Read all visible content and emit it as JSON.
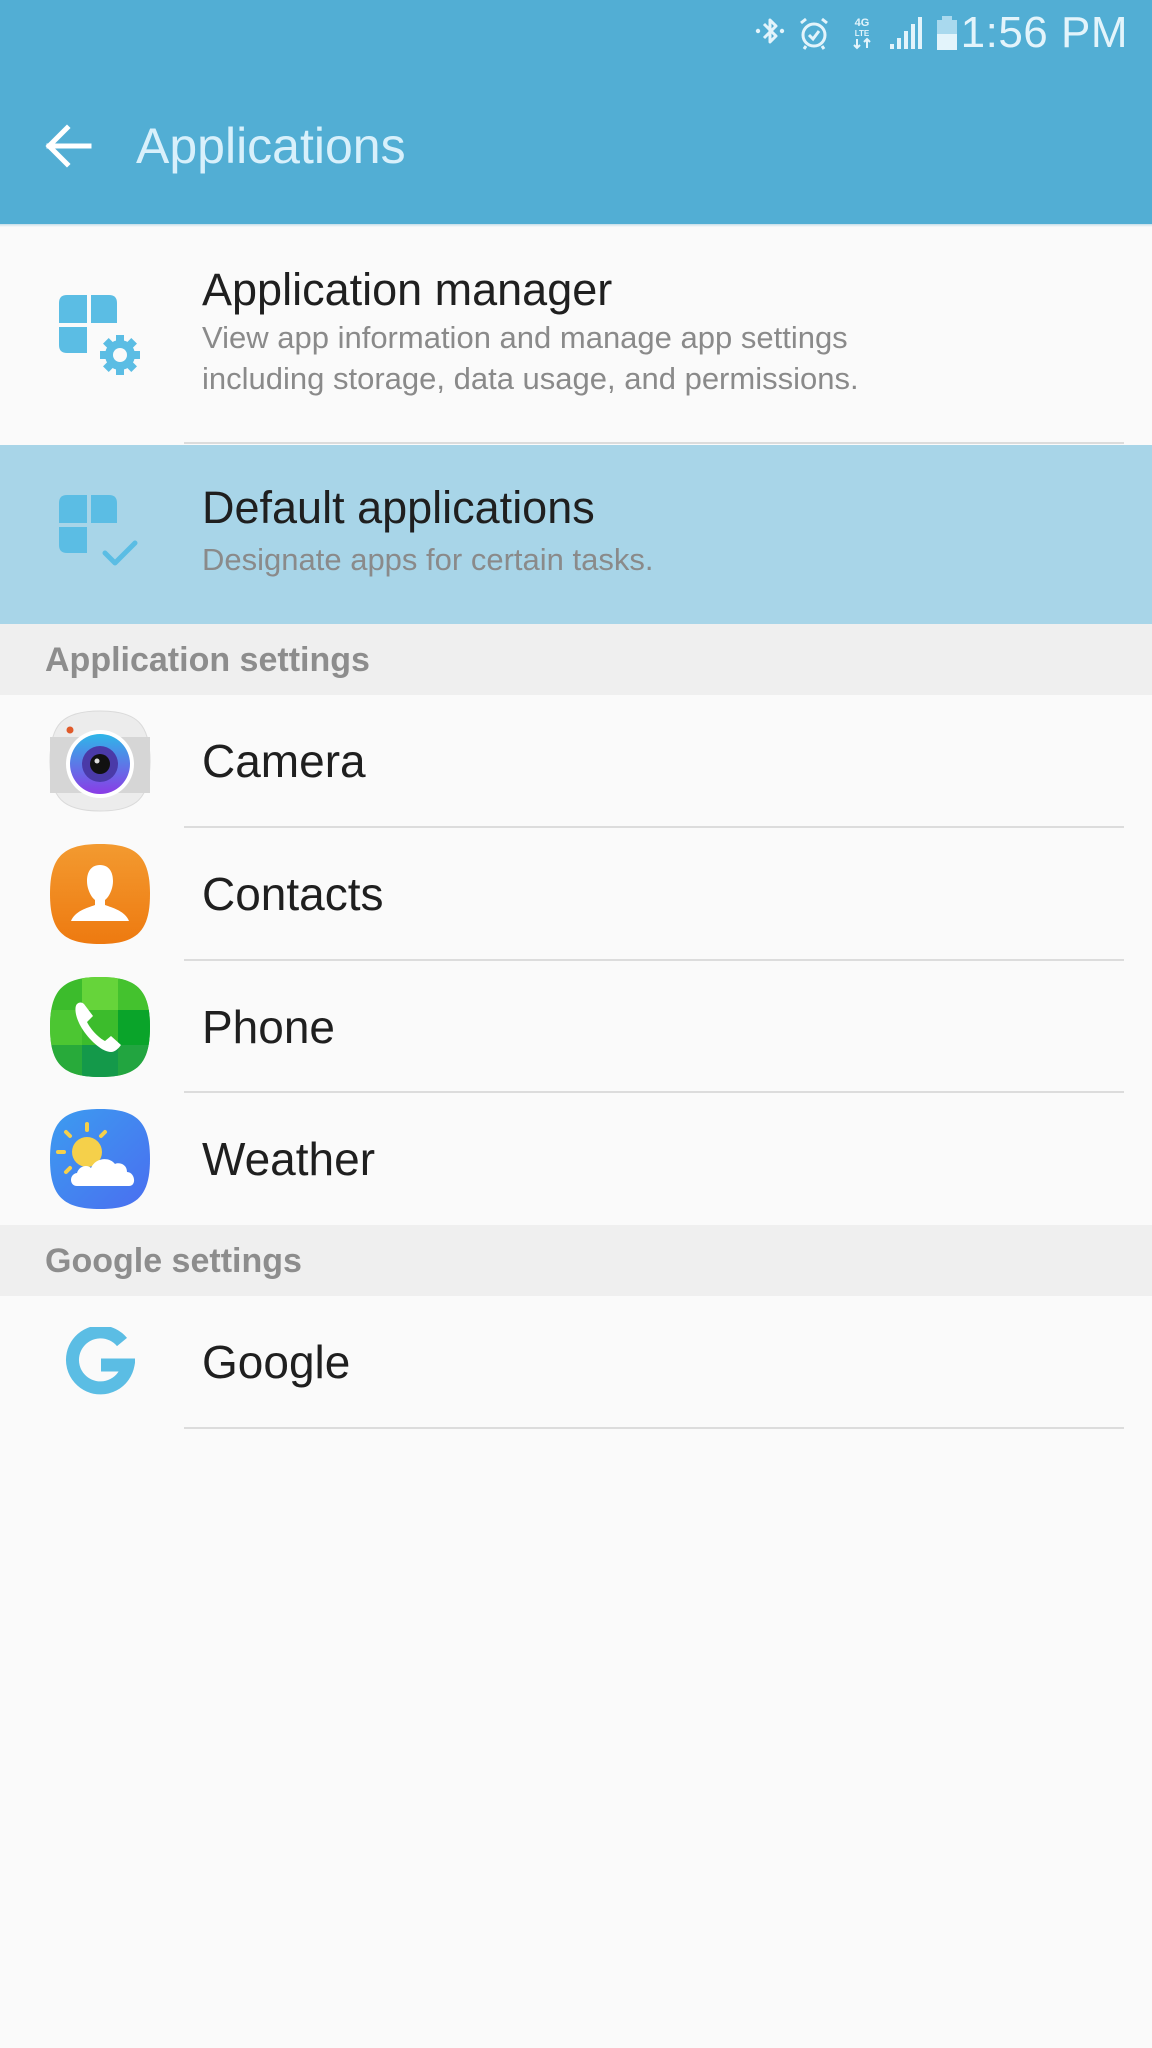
{
  "status_bar": {
    "time": "1:56 PM",
    "icons": [
      "bluetooth-icon",
      "alarm-icon",
      "4g-lte-icon",
      "signal-icon",
      "battery-icon"
    ],
    "network_label": "4G LTE"
  },
  "header": {
    "title": "Applications",
    "back_icon": "back-arrow-icon",
    "color": "#52aed4"
  },
  "top_items": [
    {
      "title": "Application manager",
      "subtitle_line1": "View app information and manage app settings",
      "subtitle_line2": "including storage, data usage, and permissions.",
      "icon": "app-manager-gear-icon",
      "highlighted": false
    },
    {
      "title": "Default applications",
      "subtitle": "Designate apps for certain tasks.",
      "icon": "default-apps-check-icon",
      "highlighted": true
    }
  ],
  "sections": [
    {
      "header": "Application settings",
      "items": [
        {
          "label": "Camera",
          "icon": "camera-app-icon"
        },
        {
          "label": "Contacts",
          "icon": "contacts-app-icon"
        },
        {
          "label": "Phone",
          "icon": "phone-app-icon"
        },
        {
          "label": "Weather",
          "icon": "weather-app-icon"
        }
      ]
    },
    {
      "header": "Google settings",
      "items": [
        {
          "label": "Google",
          "icon": "google-icon"
        }
      ]
    }
  ],
  "colors": {
    "accent": "#52aed4",
    "highlight": "#a8d5e8",
    "icon_blue": "#5bbde4",
    "section_bg": "#efefef"
  }
}
